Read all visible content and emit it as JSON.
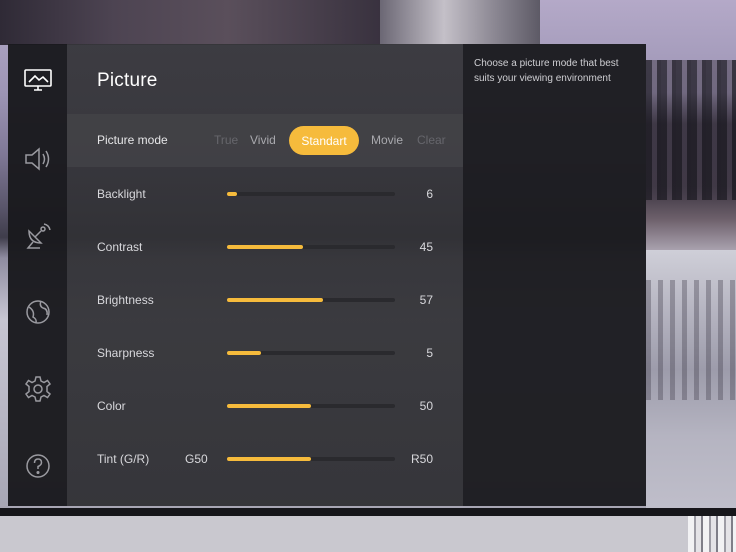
{
  "nav": {
    "items": [
      {
        "icon": "picture-icon",
        "label": "Picture",
        "active": true
      },
      {
        "icon": "sound-icon",
        "label": "Sound"
      },
      {
        "icon": "satellite-icon",
        "label": "Channels"
      },
      {
        "icon": "globe-icon",
        "label": "Network"
      },
      {
        "icon": "gear-icon",
        "label": "General"
      },
      {
        "icon": "help-icon",
        "label": "Support"
      }
    ]
  },
  "panel": {
    "title": "Picture",
    "picture_mode": {
      "label": "Picture mode",
      "options": [
        "True",
        "Vivid",
        "Standart",
        "Movie",
        "Clear"
      ],
      "selected": "Standart"
    },
    "settings": [
      {
        "label": "Backlight",
        "value": "6",
        "level": 0.06
      },
      {
        "label": "Contrast",
        "value": "45",
        "level": 0.45
      },
      {
        "label": "Brightness",
        "value": "57",
        "level": 0.57
      },
      {
        "label": "Sharpness",
        "value": "5",
        "level": 0.2
      },
      {
        "label": "Color",
        "value": "50",
        "level": 0.5
      },
      {
        "label": "Tint (G/R)",
        "min_label": "G50",
        "value": "R50",
        "level": 0.5
      }
    ]
  },
  "help": {
    "text": "Choose a picture mode that best suits your viewing environment"
  },
  "colors": {
    "accent": "#f6bb3c",
    "rail": "#1a1a1e",
    "panel": "#343438",
    "track": "#2a2a2e"
  }
}
